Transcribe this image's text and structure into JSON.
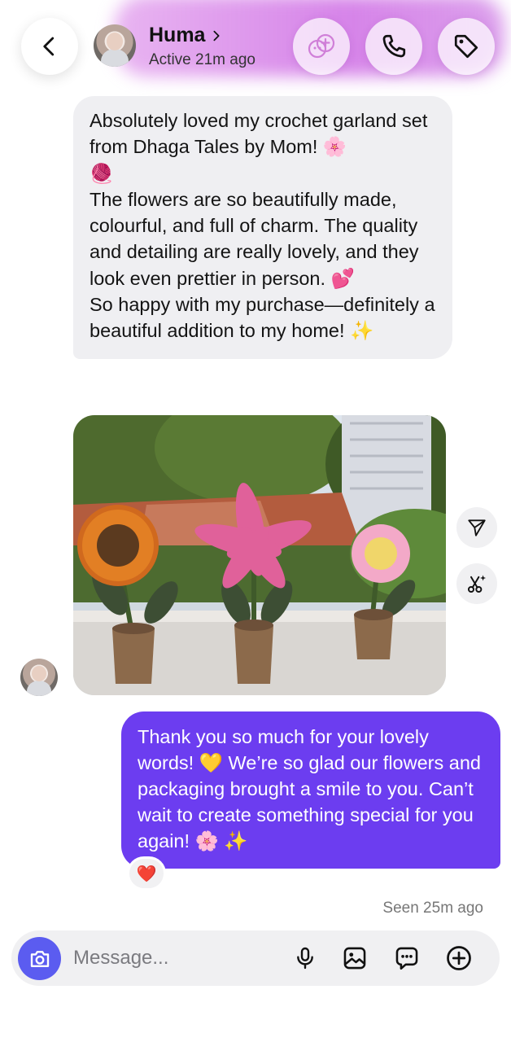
{
  "header": {
    "contact_name": "Huma",
    "status": "Active 21m ago"
  },
  "incoming": {
    "text": "Absolutely loved my crochet garland set from Dhaga Tales by Mom! 🌸\n🧶\nThe flowers are so beautifully made, colourful, and full of charm. The quality and detailing are really lovely, and they look even prettier in person. 💕\nSo happy with my purchase—definitely a beautiful addition to my home! ✨"
  },
  "outgoing": {
    "text": "Thank you so much for your lovely words! 💛 We’re so glad our flowers and packaging brought a smile to you. Can’t wait to create something special for you again! 🌸 ✨",
    "reaction": "❤️"
  },
  "seen_text": "Seen 25m ago",
  "composer": {
    "placeholder": "Message..."
  },
  "colors": {
    "accent": "#6c3df0",
    "camera": "#5b5cf0",
    "header_glow": "#c85ae1",
    "incoming_bubble": "#efeff2"
  },
  "icons": [
    "chevron-left-icon",
    "chevron-right-icon",
    "call-effects-icon",
    "phone-icon",
    "tag-icon",
    "share-icon",
    "ai-edit-icon",
    "camera-icon",
    "microphone-icon",
    "gallery-icon",
    "sticker-icon",
    "plus-icon"
  ]
}
